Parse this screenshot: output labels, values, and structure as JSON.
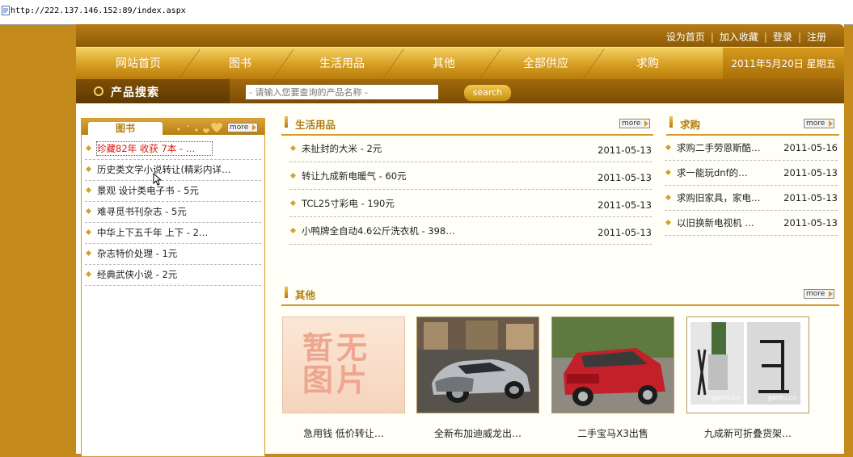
{
  "browser": {
    "url": "http://222.137.146.152:89/index.aspx"
  },
  "toplinks": [
    "设为首页",
    "加入收藏",
    "登录",
    "注册"
  ],
  "nav": {
    "items": [
      "网站首页",
      "图书",
      "生活用品",
      "其他",
      "全部供应",
      "求购"
    ],
    "date": "2011年5月20日 星期五"
  },
  "search": {
    "label": "产品搜索",
    "placeholder": "- 请输入您要查询的产品名称 -",
    "button": "search"
  },
  "more_label": "more",
  "books": {
    "title": "图书",
    "items": [
      {
        "text": "珍藏82年 收获 7本 - …"
      },
      {
        "text": "历史类文学小说转让(精彩内详…"
      },
      {
        "text": "景观 设计类电子书 - 5元"
      },
      {
        "text": "难寻觅书刊杂志 - 5元"
      },
      {
        "text": "中华上下五千年 上下 - 2…"
      },
      {
        "text": "杂志特价处理 - 1元"
      },
      {
        "text": "经典武侠小说 - 2元"
      }
    ]
  },
  "daily": {
    "title": "生活用品",
    "items": [
      {
        "text": "未扯封的大米 - 2元",
        "date": "2011-05-13"
      },
      {
        "text": "转让九成新电暖气 - 60元",
        "date": "2011-05-13"
      },
      {
        "text": "TCL25寸彩电 - 190元",
        "date": "2011-05-13"
      },
      {
        "text": "小鸭牌全自动4.6公斤洗衣机 - 398…",
        "date": "2011-05-13"
      }
    ]
  },
  "wanted": {
    "title": "求购",
    "items": [
      {
        "text": "求购二手劳恩斯酷…",
        "date": "2011-05-16"
      },
      {
        "text": "求一能玩dnf的…",
        "date": "2011-05-13"
      },
      {
        "text": "求购旧家具，家电…",
        "date": "2011-05-13"
      },
      {
        "text": "以旧换新电视机 …",
        "date": "2011-05-13"
      }
    ]
  },
  "others": {
    "title": "其他",
    "noimage_text": [
      "暂无",
      "图片"
    ],
    "watermark": "gantu.cn",
    "products": [
      {
        "caption": "急用钱 低价转让…"
      },
      {
        "caption": "全新布加迪威龙出…"
      },
      {
        "caption": "二手宝马X3出售"
      },
      {
        "caption": "九成新可折叠货架…"
      }
    ]
  }
}
